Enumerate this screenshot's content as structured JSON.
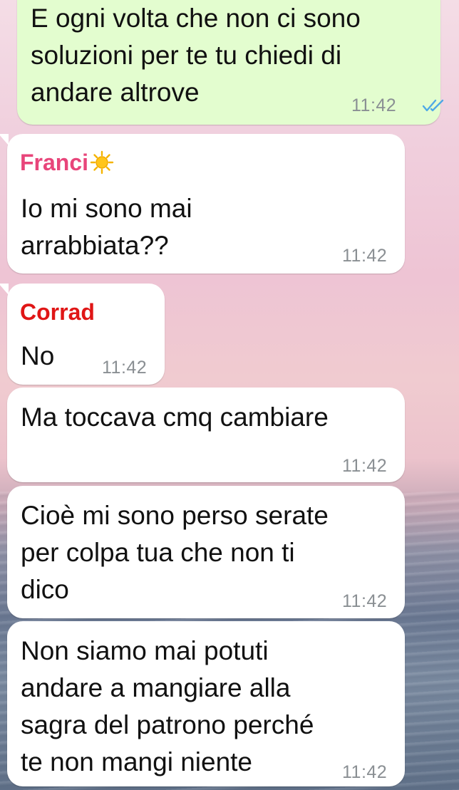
{
  "colors": {
    "outgoing_bubble": "#e3fdcf",
    "incoming_bubble": "#ffffff",
    "sender_franci": "#e8457a",
    "sender_corrad": "#e01616",
    "read_ticks": "#4fa9e6"
  },
  "messages": [
    {
      "direction": "outgoing",
      "text": "E ogni volta che non ci sono\nsoluzioni per te tu chiedi di\nandare altrove",
      "time": "11:42",
      "status_icon": "double-check-read-icon"
    },
    {
      "direction": "incoming",
      "sender": "Franci",
      "sender_icon": "sun-icon",
      "text": "Io mi sono mai\narrabbiata??",
      "time": "11:42"
    },
    {
      "direction": "incoming",
      "sender": "Corrad",
      "text": "No",
      "time": "11:42"
    },
    {
      "direction": "incoming",
      "text": "Ma toccava cmq cambiare",
      "time": "11:42"
    },
    {
      "direction": "incoming",
      "text": "Cioè mi sono perso serate\nper colpa tua che non ti\ndico",
      "time": "11:42"
    },
    {
      "direction": "incoming",
      "text": "Non siamo mai potuti\nandare a mangiare alla\nsagra del patrono perché\nte non mangi niente",
      "time": "11:42"
    }
  ]
}
